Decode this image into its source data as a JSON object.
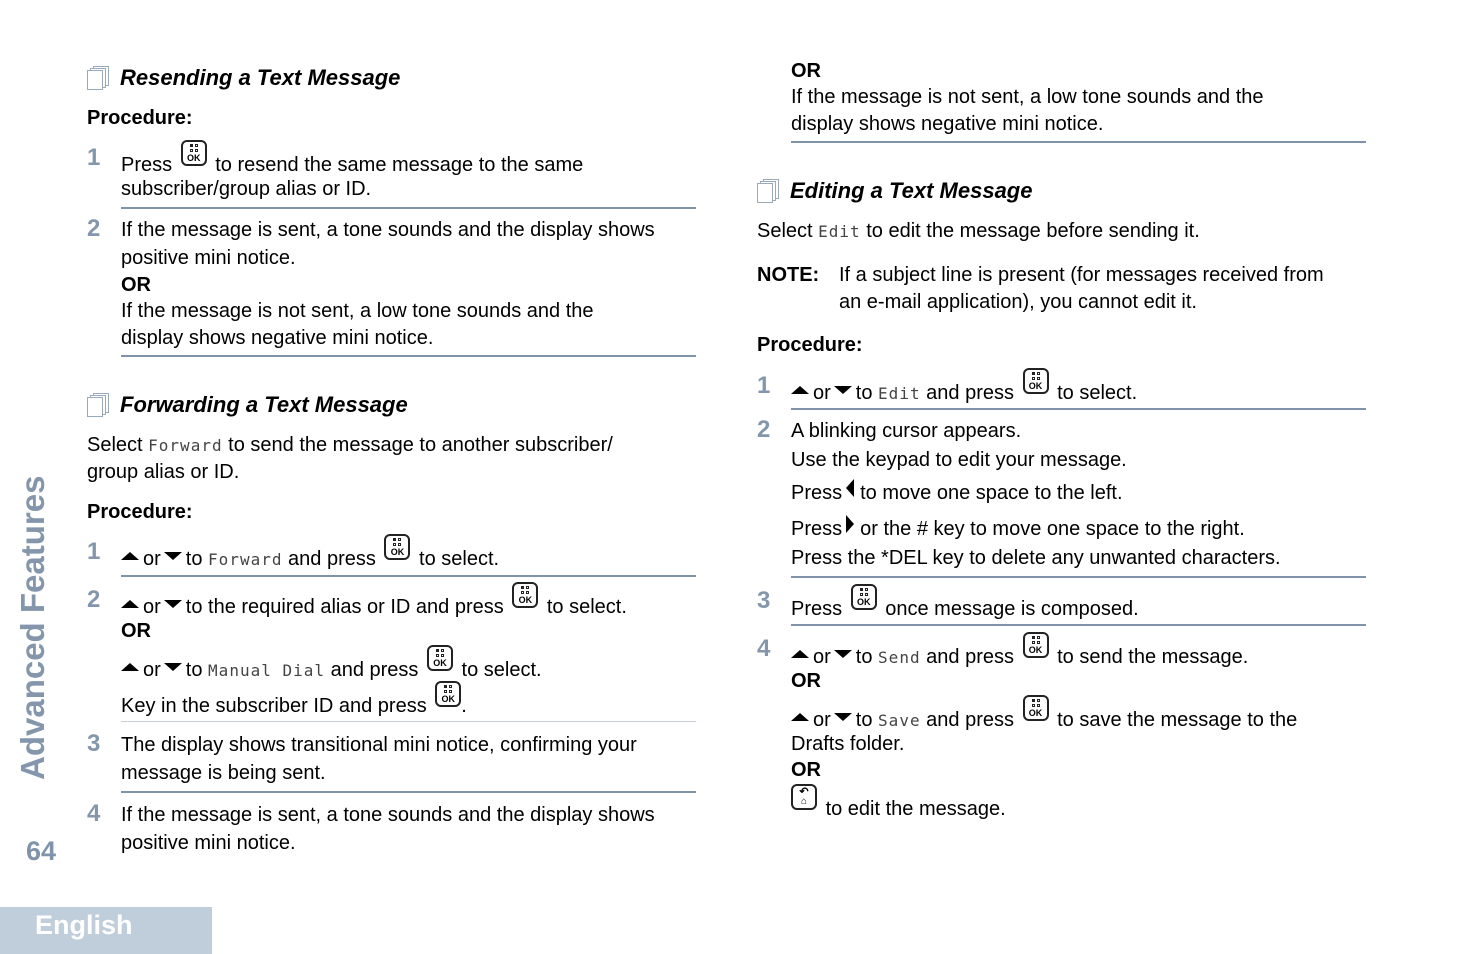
{
  "sidebar": {
    "chapter": "Advanced Features",
    "page_number": "64",
    "language_tab": "English"
  },
  "icons": {
    "section": "document-stack-icon",
    "ok_key": "menu-ok-key-icon",
    "up": "arrow-up-icon",
    "down": "arrow-down-icon",
    "left": "arrow-left-icon",
    "right": "arrow-right-icon",
    "back_home": "back-home-key-icon"
  },
  "common": {
    "procedure": "Procedure:",
    "or": "OR",
    "or_word": "or",
    "to": "to",
    "and_press": "and press",
    "to_select": "to select."
  },
  "resending": {
    "title": "Resending a Text Message",
    "step1": {
      "num": "1",
      "pre": "Press",
      "post": "to resend the same message to the same",
      "line2": "subscriber/group alias or ID."
    },
    "step2": {
      "num": "2",
      "line1": "If the message is sent, a tone sounds and the display shows",
      "line2": "positive mini notice.",
      "line4": "If the message is not sent, a low tone sounds and the",
      "line5": "display shows negative mini notice."
    }
  },
  "forwarding": {
    "title": "Forwarding a Text Message",
    "intro_pre": "Select",
    "intro_code": "Forward",
    "intro_post": "to send the message to another subscriber/",
    "intro_line2": "group alias or ID.",
    "step1": {
      "num": "1",
      "code": "Forward"
    },
    "step2": {
      "num": "2",
      "line1_post": "to the required alias or ID and press",
      "code": "Manual Dial",
      "key_in": "Key in the subscriber ID and press",
      "period": "."
    },
    "step3": {
      "num": "3",
      "line1": "The display shows transitional mini notice, confirming your",
      "line2": "message is being sent."
    },
    "step4": {
      "num": "4",
      "line1": "If the message is sent, a tone sounds and the display shows",
      "line2": "positive mini notice."
    }
  },
  "continued": {
    "line2": "If the message is not sent, a low tone sounds and the",
    "line3": "display shows negative mini notice."
  },
  "editing": {
    "title": "Editing a Text Message",
    "intro_pre": "Select",
    "intro_code": "Edit",
    "intro_post": "to edit the message before sending it.",
    "note_label": "NOTE:",
    "note_line1": "If a subject line is present (for messages received from",
    "note_line2": "an e-mail application), you cannot edit it.",
    "step1": {
      "num": "1",
      "code": "Edit"
    },
    "step2": {
      "num": "2",
      "line1": "A blinking cursor appears.",
      "line2": "Use the keypad to edit your message.",
      "line3_pre": "Press",
      "line3_post": "to move one space to the left.",
      "line4_pre": "Press",
      "line4_post": "or the # key to move one space to the right.",
      "line5": "Press the *DEL key to delete any unwanted characters."
    },
    "step3": {
      "num": "3",
      "pre": "Press",
      "post": "once message is composed."
    },
    "step4": {
      "num": "4",
      "code_send": "Send",
      "send_post": "to send the message.",
      "code_save": "Save",
      "save_post": "to save the message to the",
      "save_line2": "Drafts folder.",
      "back_post": "to edit the message."
    }
  }
}
